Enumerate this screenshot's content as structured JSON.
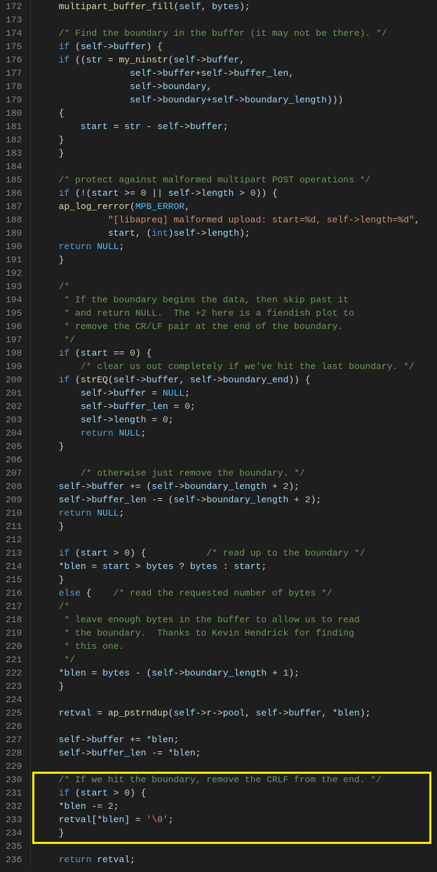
{
  "startLine": 172,
  "endLine": 236,
  "highlight": {
    "fromLine": 230,
    "toLine": 234
  },
  "lines": [
    [
      [
        "ws",
        "    "
      ],
      [
        "fn",
        "multipart_buffer_fill"
      ],
      [
        "op",
        "("
      ],
      [
        "id",
        "self"
      ],
      [
        "op",
        ", "
      ],
      [
        "id",
        "bytes"
      ],
      [
        "op",
        ");"
      ]
    ],
    [],
    [
      [
        "ws",
        "    "
      ],
      [
        "cmt",
        "/* Find the boundary in the buffer (it may not be there). */"
      ]
    ],
    [
      [
        "ws",
        "    "
      ],
      [
        "kw",
        "if"
      ],
      [
        "op",
        " ("
      ],
      [
        "id",
        "self"
      ],
      [
        "op",
        "->"
      ],
      [
        "id",
        "buffer"
      ],
      [
        "op",
        ") {"
      ]
    ],
    [
      [
        "ws",
        "    "
      ],
      [
        "kw",
        "if"
      ],
      [
        "op",
        " (("
      ],
      [
        "id",
        "str"
      ],
      [
        "op",
        " = "
      ],
      [
        "fn",
        "my_ninstr"
      ],
      [
        "op",
        "("
      ],
      [
        "id",
        "self"
      ],
      [
        "op",
        "->"
      ],
      [
        "id",
        "buffer"
      ],
      [
        "op",
        ","
      ]
    ],
    [
      [
        "ws",
        "                 "
      ],
      [
        "id",
        "self"
      ],
      [
        "op",
        "->"
      ],
      [
        "id",
        "buffer"
      ],
      [
        "op",
        "+"
      ],
      [
        "id",
        "self"
      ],
      [
        "op",
        "->"
      ],
      [
        "id",
        "buffer_len"
      ],
      [
        "op",
        ","
      ]
    ],
    [
      [
        "ws",
        "                 "
      ],
      [
        "id",
        "self"
      ],
      [
        "op",
        "->"
      ],
      [
        "id",
        "boundary"
      ],
      [
        "op",
        ","
      ]
    ],
    [
      [
        "ws",
        "                 "
      ],
      [
        "id",
        "self"
      ],
      [
        "op",
        "->"
      ],
      [
        "id",
        "boundary"
      ],
      [
        "op",
        "+"
      ],
      [
        "id",
        "self"
      ],
      [
        "op",
        "->"
      ],
      [
        "id",
        "boundary_length"
      ],
      [
        "op",
        ")))"
      ]
    ],
    [
      [
        "ws",
        "    "
      ],
      [
        "op",
        "{"
      ]
    ],
    [
      [
        "ws",
        "        "
      ],
      [
        "id",
        "start"
      ],
      [
        "op",
        " = "
      ],
      [
        "id",
        "str"
      ],
      [
        "op",
        " - "
      ],
      [
        "id",
        "self"
      ],
      [
        "op",
        "->"
      ],
      [
        "id",
        "buffer"
      ],
      [
        "op",
        ";"
      ]
    ],
    [
      [
        "ws",
        "    "
      ],
      [
        "op",
        "}"
      ]
    ],
    [
      [
        "ws",
        "    "
      ],
      [
        "op",
        "}"
      ]
    ],
    [],
    [
      [
        "ws",
        "    "
      ],
      [
        "cmt",
        "/* protect against malformed multipart POST operations */"
      ]
    ],
    [
      [
        "ws",
        "    "
      ],
      [
        "kw",
        "if"
      ],
      [
        "op",
        " (!("
      ],
      [
        "id",
        "start"
      ],
      [
        "op",
        " >= "
      ],
      [
        "num",
        "0"
      ],
      [
        "op",
        " || "
      ],
      [
        "id",
        "self"
      ],
      [
        "op",
        "->"
      ],
      [
        "id",
        "length"
      ],
      [
        "op",
        " > "
      ],
      [
        "num",
        "0"
      ],
      [
        "op",
        ")) {"
      ]
    ],
    [
      [
        "ws",
        "    "
      ],
      [
        "fn",
        "ap_log_rerror"
      ],
      [
        "op",
        "("
      ],
      [
        "const",
        "MPB_ERROR"
      ],
      [
        "op",
        ","
      ]
    ],
    [
      [
        "ws",
        "             "
      ],
      [
        "str",
        "\"[libapreq] malformed upload: start=%d, self->length=%d\""
      ],
      [
        "op",
        ","
      ]
    ],
    [
      [
        "ws",
        "             "
      ],
      [
        "id",
        "start"
      ],
      [
        "op",
        ", ("
      ],
      [
        "kw",
        "int"
      ],
      [
        "op",
        ")"
      ],
      [
        "id",
        "self"
      ],
      [
        "op",
        "->"
      ],
      [
        "id",
        "length"
      ],
      [
        "op",
        ");"
      ]
    ],
    [
      [
        "ws",
        "    "
      ],
      [
        "kw",
        "return"
      ],
      [
        "op",
        " "
      ],
      [
        "const",
        "NULL"
      ],
      [
        "op",
        ";"
      ]
    ],
    [
      [
        "ws",
        "    "
      ],
      [
        "op",
        "}"
      ]
    ],
    [],
    [
      [
        "ws",
        "    "
      ],
      [
        "cmt",
        "/*"
      ]
    ],
    [
      [
        "ws",
        "     "
      ],
      [
        "cmt",
        "* If the boundary begins the data, then skip past it"
      ]
    ],
    [
      [
        "ws",
        "     "
      ],
      [
        "cmt",
        "* and return NULL.  The +2 here is a fiendish plot to"
      ]
    ],
    [
      [
        "ws",
        "     "
      ],
      [
        "cmt",
        "* remove the CR/LF pair at the end of the boundary."
      ]
    ],
    [
      [
        "ws",
        "     "
      ],
      [
        "cmt",
        "*/"
      ]
    ],
    [
      [
        "ws",
        "    "
      ],
      [
        "kw",
        "if"
      ],
      [
        "op",
        " ("
      ],
      [
        "id",
        "start"
      ],
      [
        "op",
        " == "
      ],
      [
        "num",
        "0"
      ],
      [
        "op",
        ") {"
      ]
    ],
    [
      [
        "ws",
        "        "
      ],
      [
        "cmt",
        "/* clear us out completely if we've hit the last boundary. */"
      ]
    ],
    [
      [
        "ws",
        "    "
      ],
      [
        "kw",
        "if"
      ],
      [
        "op",
        " ("
      ],
      [
        "fn",
        "strEQ"
      ],
      [
        "op",
        "("
      ],
      [
        "id",
        "self"
      ],
      [
        "op",
        "->"
      ],
      [
        "id",
        "buffer"
      ],
      [
        "op",
        ", "
      ],
      [
        "id",
        "self"
      ],
      [
        "op",
        "->"
      ],
      [
        "id",
        "boundary_end"
      ],
      [
        "op",
        ")) {"
      ]
    ],
    [
      [
        "ws",
        "        "
      ],
      [
        "id",
        "self"
      ],
      [
        "op",
        "->"
      ],
      [
        "id",
        "buffer"
      ],
      [
        "op",
        " = "
      ],
      [
        "const",
        "NULL"
      ],
      [
        "op",
        ";"
      ]
    ],
    [
      [
        "ws",
        "        "
      ],
      [
        "id",
        "self"
      ],
      [
        "op",
        "->"
      ],
      [
        "id",
        "buffer_len"
      ],
      [
        "op",
        " = "
      ],
      [
        "num",
        "0"
      ],
      [
        "op",
        ";"
      ]
    ],
    [
      [
        "ws",
        "        "
      ],
      [
        "id",
        "self"
      ],
      [
        "op",
        "->"
      ],
      [
        "id",
        "length"
      ],
      [
        "op",
        " = "
      ],
      [
        "num",
        "0"
      ],
      [
        "op",
        ";"
      ]
    ],
    [
      [
        "ws",
        "        "
      ],
      [
        "kw",
        "return"
      ],
      [
        "op",
        " "
      ],
      [
        "const",
        "NULL"
      ],
      [
        "op",
        ";"
      ]
    ],
    [
      [
        "ws",
        "    "
      ],
      [
        "op",
        "}"
      ]
    ],
    [],
    [
      [
        "ws",
        "        "
      ],
      [
        "cmt",
        "/* otherwise just remove the boundary. */"
      ]
    ],
    [
      [
        "ws",
        "    "
      ],
      [
        "id",
        "self"
      ],
      [
        "op",
        "->"
      ],
      [
        "id",
        "buffer"
      ],
      [
        "op",
        " += ("
      ],
      [
        "id",
        "self"
      ],
      [
        "op",
        "->"
      ],
      [
        "id",
        "boundary_length"
      ],
      [
        "op",
        " + "
      ],
      [
        "num",
        "2"
      ],
      [
        "op",
        ");"
      ]
    ],
    [
      [
        "ws",
        "    "
      ],
      [
        "id",
        "self"
      ],
      [
        "op",
        "->"
      ],
      [
        "id",
        "buffer_len"
      ],
      [
        "op",
        " -= ("
      ],
      [
        "id",
        "self"
      ],
      [
        "op",
        "->"
      ],
      [
        "id",
        "boundary_length"
      ],
      [
        "op",
        " + "
      ],
      [
        "num",
        "2"
      ],
      [
        "op",
        ");"
      ]
    ],
    [
      [
        "ws",
        "    "
      ],
      [
        "kw",
        "return"
      ],
      [
        "op",
        " "
      ],
      [
        "const",
        "NULL"
      ],
      [
        "op",
        ";"
      ]
    ],
    [
      [
        "ws",
        "    "
      ],
      [
        "op",
        "}"
      ]
    ],
    [],
    [
      [
        "ws",
        "    "
      ],
      [
        "kw",
        "if"
      ],
      [
        "op",
        " ("
      ],
      [
        "id",
        "start"
      ],
      [
        "op",
        " > "
      ],
      [
        "num",
        "0"
      ],
      [
        "op",
        ") {           "
      ],
      [
        "cmt",
        "/* read up to the boundary */"
      ]
    ],
    [
      [
        "ws",
        "    "
      ],
      [
        "op",
        "*"
      ],
      [
        "id",
        "blen"
      ],
      [
        "op",
        " = "
      ],
      [
        "id",
        "start"
      ],
      [
        "op",
        " > "
      ],
      [
        "id",
        "bytes"
      ],
      [
        "op",
        " ? "
      ],
      [
        "id",
        "bytes"
      ],
      [
        "op",
        " : "
      ],
      [
        "id",
        "start"
      ],
      [
        "op",
        ";"
      ]
    ],
    [
      [
        "ws",
        "    "
      ],
      [
        "op",
        "}"
      ]
    ],
    [
      [
        "ws",
        "    "
      ],
      [
        "kw",
        "else"
      ],
      [
        "op",
        " {    "
      ],
      [
        "cmt",
        "/* read the requested number of bytes */"
      ]
    ],
    [
      [
        "ws",
        "    "
      ],
      [
        "cmt",
        "/*"
      ]
    ],
    [
      [
        "ws",
        "     "
      ],
      [
        "cmt",
        "* leave enough bytes in the buffer to allow us to read"
      ]
    ],
    [
      [
        "ws",
        "     "
      ],
      [
        "cmt",
        "* the boundary.  Thanks to Kevin Hendrick for finding"
      ]
    ],
    [
      [
        "ws",
        "     "
      ],
      [
        "cmt",
        "* this one."
      ]
    ],
    [
      [
        "ws",
        "     "
      ],
      [
        "cmt",
        "*/"
      ]
    ],
    [
      [
        "ws",
        "    "
      ],
      [
        "op",
        "*"
      ],
      [
        "id",
        "blen"
      ],
      [
        "op",
        " = "
      ],
      [
        "id",
        "bytes"
      ],
      [
        "op",
        " - ("
      ],
      [
        "id",
        "self"
      ],
      [
        "op",
        "->"
      ],
      [
        "id",
        "boundary_length"
      ],
      [
        "op",
        " + "
      ],
      [
        "num",
        "1"
      ],
      [
        "op",
        ");"
      ]
    ],
    [
      [
        "ws",
        "    "
      ],
      [
        "op",
        "}"
      ]
    ],
    [],
    [
      [
        "ws",
        "    "
      ],
      [
        "id",
        "retval"
      ],
      [
        "op",
        " = "
      ],
      [
        "fn",
        "ap_pstrndup"
      ],
      [
        "op",
        "("
      ],
      [
        "id",
        "self"
      ],
      [
        "op",
        "->"
      ],
      [
        "id",
        "r"
      ],
      [
        "op",
        "->"
      ],
      [
        "id",
        "pool"
      ],
      [
        "op",
        ", "
      ],
      [
        "id",
        "self"
      ],
      [
        "op",
        "->"
      ],
      [
        "id",
        "buffer"
      ],
      [
        "op",
        ", *"
      ],
      [
        "id",
        "blen"
      ],
      [
        "op",
        ");"
      ]
    ],
    [],
    [
      [
        "ws",
        "    "
      ],
      [
        "id",
        "self"
      ],
      [
        "op",
        "->"
      ],
      [
        "id",
        "buffer"
      ],
      [
        "op",
        " += *"
      ],
      [
        "id",
        "blen"
      ],
      [
        "op",
        ";"
      ]
    ],
    [
      [
        "ws",
        "    "
      ],
      [
        "id",
        "self"
      ],
      [
        "op",
        "->"
      ],
      [
        "id",
        "buffer_len"
      ],
      [
        "op",
        " -= *"
      ],
      [
        "id",
        "blen"
      ],
      [
        "op",
        ";"
      ]
    ],
    [],
    [
      [
        "ws",
        "    "
      ],
      [
        "cmt",
        "/* If we hit the boundary, remove the CRLF from the end. */"
      ]
    ],
    [
      [
        "ws",
        "    "
      ],
      [
        "kw",
        "if"
      ],
      [
        "op",
        " ("
      ],
      [
        "id",
        "start"
      ],
      [
        "op",
        " > "
      ],
      [
        "num",
        "0"
      ],
      [
        "op",
        ") {"
      ]
    ],
    [
      [
        "ws",
        "    "
      ],
      [
        "op",
        "*"
      ],
      [
        "id",
        "blen"
      ],
      [
        "op",
        " -= "
      ],
      [
        "num",
        "2"
      ],
      [
        "op",
        ";"
      ]
    ],
    [
      [
        "ws",
        "    "
      ],
      [
        "id",
        "retval"
      ],
      [
        "op",
        "[*"
      ],
      [
        "id",
        "blen"
      ],
      [
        "op",
        "] = "
      ],
      [
        "str",
        "'\\0'"
      ],
      [
        "op",
        ";"
      ]
    ],
    [
      [
        "ws",
        "    "
      ],
      [
        "op",
        "}"
      ]
    ],
    [],
    [
      [
        "ws",
        "    "
      ],
      [
        "kw",
        "return"
      ],
      [
        "op",
        " "
      ],
      [
        "id",
        "retval"
      ],
      [
        "op",
        ";"
      ]
    ]
  ]
}
